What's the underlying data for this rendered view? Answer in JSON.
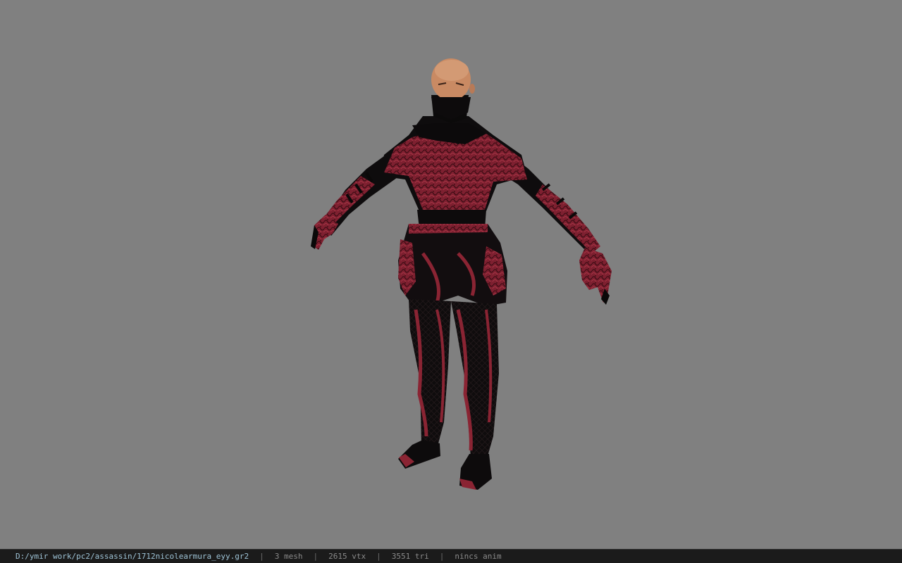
{
  "viewer": {
    "background_color": "#808080",
    "model": {
      "name": "assassin-armor-model",
      "armor_primary_color": "#8a2433",
      "armor_dark_color": "#0d0b0c",
      "skin_color": "#c98a63"
    }
  },
  "status_bar": {
    "file_path": "D:/ymir work/pc2/assassin/1712nicolearmura_eyy.gr2",
    "mesh_count": "3 mesh",
    "vertex_count": "2615 vtx",
    "triangle_count": "3551 tri",
    "anim_status": "nincs anim",
    "separator": "|"
  }
}
